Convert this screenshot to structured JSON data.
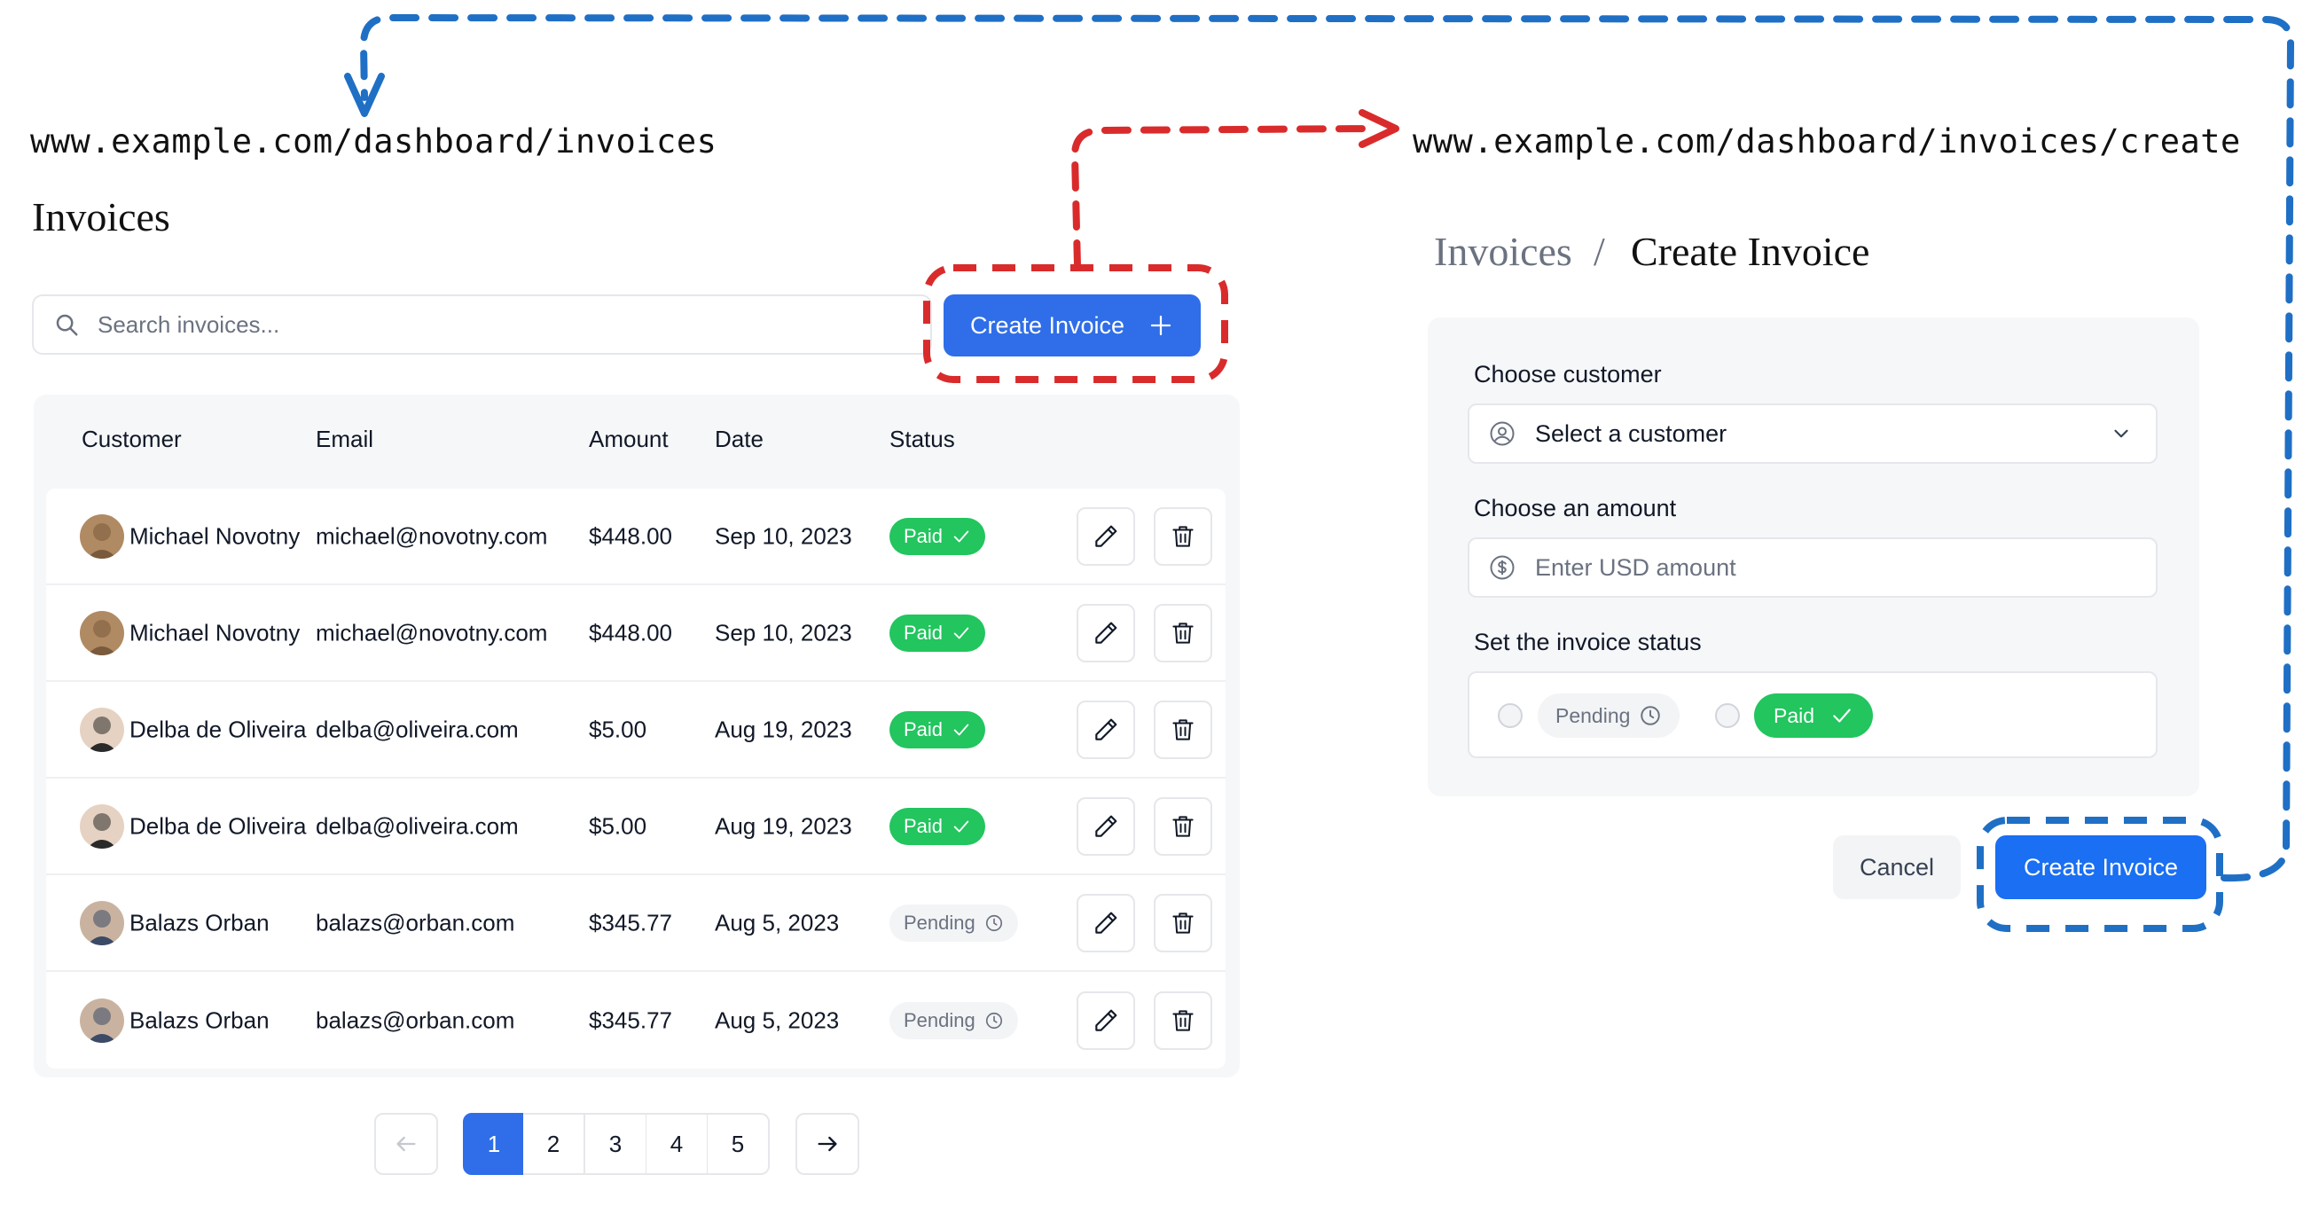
{
  "urls": {
    "list": "www.example.com/dashboard/invoices",
    "create": "www.example.com/dashboard/invoices/create"
  },
  "list_page": {
    "title": "Invoices",
    "search_placeholder": "Search invoices...",
    "create_button_label": "Create Invoice",
    "columns": [
      "Customer",
      "Email",
      "Amount",
      "Date",
      "Status"
    ],
    "rows": [
      {
        "customer": "Michael Novotny",
        "email": "michael@novotny.com",
        "amount": "$448.00",
        "date": "Sep 10, 2023",
        "status": "Paid"
      },
      {
        "customer": "Michael Novotny",
        "email": "michael@novotny.com",
        "amount": "$448.00",
        "date": "Sep 10, 2023",
        "status": "Paid"
      },
      {
        "customer": "Delba de Oliveira",
        "email": "delba@oliveira.com",
        "amount": "$5.00",
        "date": "Aug 19, 2023",
        "status": "Paid"
      },
      {
        "customer": "Delba de Oliveira",
        "email": "delba@oliveira.com",
        "amount": "$5.00",
        "date": "Aug 19, 2023",
        "status": "Paid"
      },
      {
        "customer": "Balazs Orban",
        "email": "balazs@orban.com",
        "amount": "$345.77",
        "date": "Aug 5, 2023",
        "status": "Pending"
      },
      {
        "customer": "Balazs Orban",
        "email": "balazs@orban.com",
        "amount": "$345.77",
        "date": "Aug 5, 2023",
        "status": "Pending"
      }
    ],
    "pagination": {
      "pages": [
        "1",
        "2",
        "3",
        "4",
        "5"
      ],
      "current": "1"
    }
  },
  "create_page": {
    "breadcrumb": {
      "parent": "Invoices",
      "separator": "/",
      "current": "Create Invoice"
    },
    "customer_label": "Choose customer",
    "customer_placeholder": "Select a customer",
    "amount_label": "Choose an amount",
    "amount_placeholder": "Enter USD amount",
    "status_label": "Set the invoice status",
    "status_options": [
      "Pending",
      "Paid"
    ],
    "cancel_label": "Cancel",
    "submit_label": "Create Invoice"
  },
  "icons": {
    "search": "search-icon",
    "plus": "plus-icon",
    "edit": "pencil-icon",
    "delete": "trash-icon",
    "user": "user-circle-icon",
    "dollar": "dollar-circle-icon",
    "chevron": "chevron-down-icon",
    "check": "check-icon",
    "clock": "clock-icon",
    "arrow_left": "arrow-left-icon",
    "arrow_right": "arrow-right-icon"
  },
  "colors": {
    "primary": "#2f6ee8",
    "paid": "#22c55e",
    "pending_bg": "#f3f4f6",
    "annotation_red": "#d92b2b",
    "annotation_blue": "#1f6fc5"
  }
}
